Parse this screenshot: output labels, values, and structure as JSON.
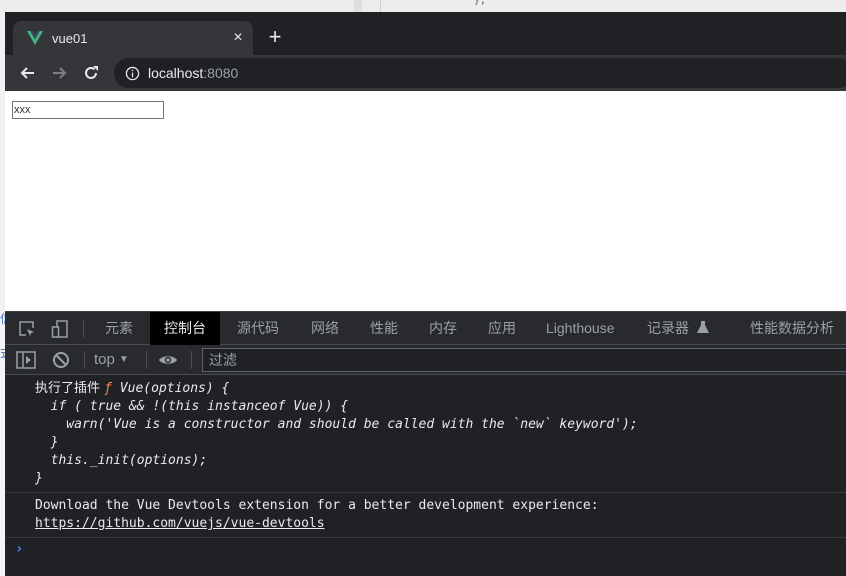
{
  "browser": {
    "tab": {
      "title": "vue01",
      "favicon": "vue-logo-icon",
      "close": "×"
    },
    "new_tab": "+",
    "nav": {
      "back": "back-arrow-icon",
      "forward": "forward-arrow-icon",
      "reload": "reload-icon"
    },
    "address": {
      "host": "localhost",
      "port": ":8080",
      "security": "info-icon"
    }
  },
  "page": {
    "input_value": "xxx"
  },
  "devtools": {
    "tabs": [
      {
        "label": "元素",
        "active": false
      },
      {
        "label": "控制台",
        "active": true
      },
      {
        "label": "源代码",
        "active": false
      },
      {
        "label": "网络",
        "active": false
      },
      {
        "label": "性能",
        "active": false
      },
      {
        "label": "内存",
        "active": false
      },
      {
        "label": "应用",
        "active": false
      },
      {
        "label": "Lighthouse",
        "active": false
      },
      {
        "label": "记录器",
        "active": false
      },
      {
        "label": "性能数据分析",
        "active": false
      }
    ],
    "toolbar": {
      "context": "top",
      "filter_placeholder": "过滤"
    },
    "console": {
      "messages": [
        {
          "prefix": "执行了插件 ",
          "fn_marker": "ƒ",
          "lines": [
            " Vue(options) {",
            "  if ( true && !(this instanceof Vue)) {",
            "    warn('Vue is a constructor and should be called with the `new` keyword');",
            "  }",
            "  this._init(options);",
            "}"
          ]
        },
        {
          "text": "Download the Vue Devtools extension for a better development experience:",
          "link": "https://github.com/vuejs/vue-devtools"
        }
      ],
      "prompt": "›"
    }
  },
  "background": {
    "editor_snippet": "},",
    "side_fragments": [
      "信",
      "式"
    ]
  }
}
